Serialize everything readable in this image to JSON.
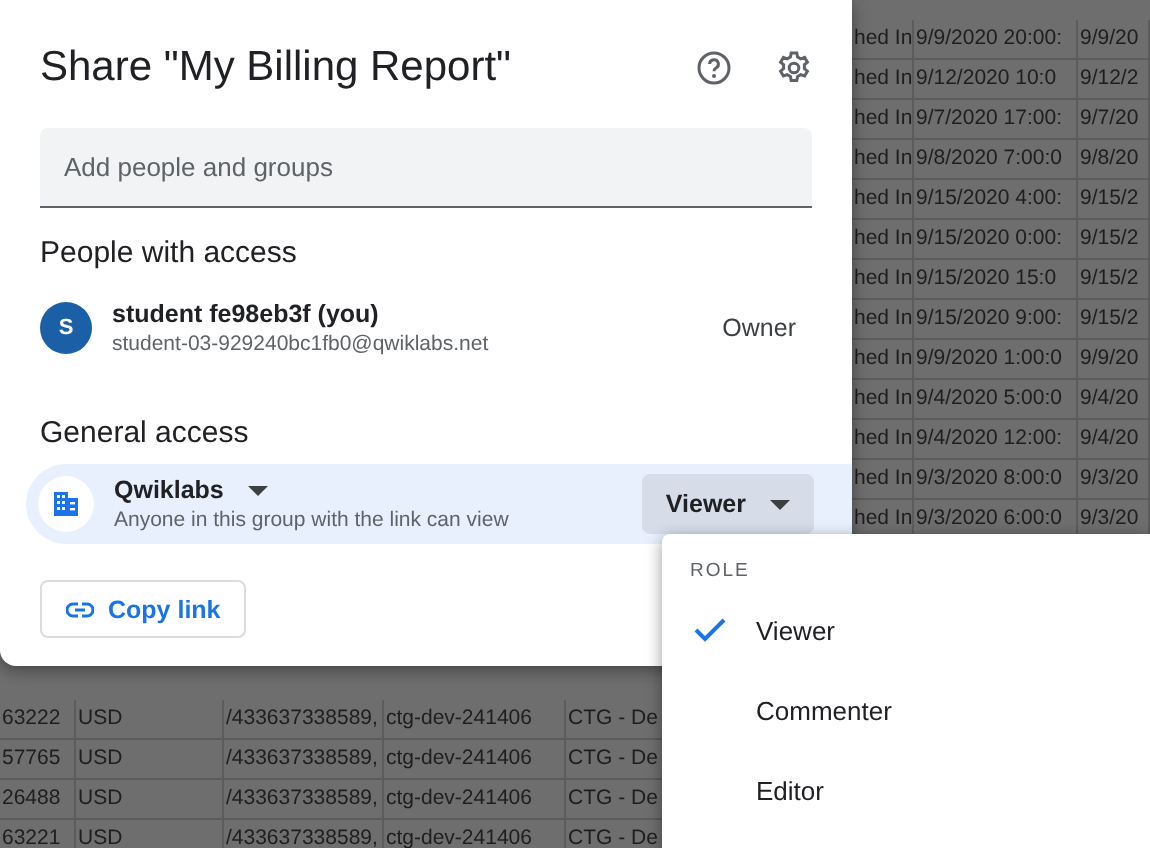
{
  "spreadsheet": {
    "upper_rows": [
      {
        "column_6": "hed In",
        "column_7": "9/9/2020 20:00:",
        "column_8": "9/9/20"
      },
      {
        "column_6": "hed In",
        "column_7": "9/12/2020 10:0",
        "column_8": "9/12/2"
      },
      {
        "column_6": "hed In",
        "column_7": "9/7/2020 17:00:",
        "column_8": "9/7/20"
      },
      {
        "column_6": "hed In",
        "column_7": "9/8/2020 7:00:0",
        "column_8": "9/8/20"
      },
      {
        "column_6": "hed In",
        "column_7": "9/15/2020 4:00:",
        "column_8": "9/15/2"
      },
      {
        "column_6": "hed In",
        "column_7": "9/15/2020 0:00:",
        "column_8": "9/15/2"
      },
      {
        "column_6": "hed In",
        "column_7": "9/15/2020 15:0",
        "column_8": "9/15/2"
      },
      {
        "column_6": "hed In",
        "column_7": "9/15/2020 9:00:",
        "column_8": "9/15/2"
      },
      {
        "column_6": "hed In",
        "column_7": "9/9/2020 1:00:0",
        "column_8": "9/9/20"
      },
      {
        "column_6": "hed In",
        "column_7": "9/4/2020 5:00:0",
        "column_8": "9/4/20"
      },
      {
        "column_6": "hed In",
        "column_7": "9/4/2020 12:00:",
        "column_8": "9/4/20"
      },
      {
        "column_6": "hed In",
        "column_7": "9/3/2020 8:00:0",
        "column_8": "9/3/20"
      },
      {
        "column_6": "hed In",
        "column_7": "9/3/2020 6:00:0",
        "column_8": "9/3/20"
      }
    ],
    "lower_rows": [
      {
        "column_1": "63222",
        "column_2": "USD",
        "column_3": "/433637338589,",
        "column_4": "ctg-dev-241406",
        "column_5": "CTG - De"
      },
      {
        "column_1": "57765",
        "column_2": "USD",
        "column_3": "/433637338589,",
        "column_4": "ctg-dev-241406",
        "column_5": "CTG - De"
      },
      {
        "column_1": "26488",
        "column_2": "USD",
        "column_3": "/433637338589,",
        "column_4": "ctg-dev-241406",
        "column_5": "CTG - De"
      },
      {
        "column_1": "63221",
        "column_2": "USD",
        "column_3": "/433637338589,",
        "column_4": "ctg-dev-241406",
        "column_5": "CTG - De"
      }
    ]
  },
  "dialog": {
    "title": "Share \"My Billing Report\"",
    "search": {
      "placeholder": "Add people and groups"
    },
    "people_heading": "People with access",
    "people": [
      {
        "initial": "S",
        "name": "student fe98eb3f (you)",
        "email": "student-03-929240bc1fb0@qwiklabs.net",
        "role": "Owner"
      }
    ],
    "general_heading": "General access",
    "general_access": {
      "group": "Qwiklabs",
      "description": "Anyone in this group with the link can view",
      "role": "Viewer"
    },
    "copy_link": "Copy link"
  },
  "role_menu": {
    "heading": "ROLE",
    "items": [
      {
        "label": "Viewer",
        "selected": true
      },
      {
        "label": "Commenter",
        "selected": false
      },
      {
        "label": "Editor",
        "selected": false
      }
    ]
  }
}
